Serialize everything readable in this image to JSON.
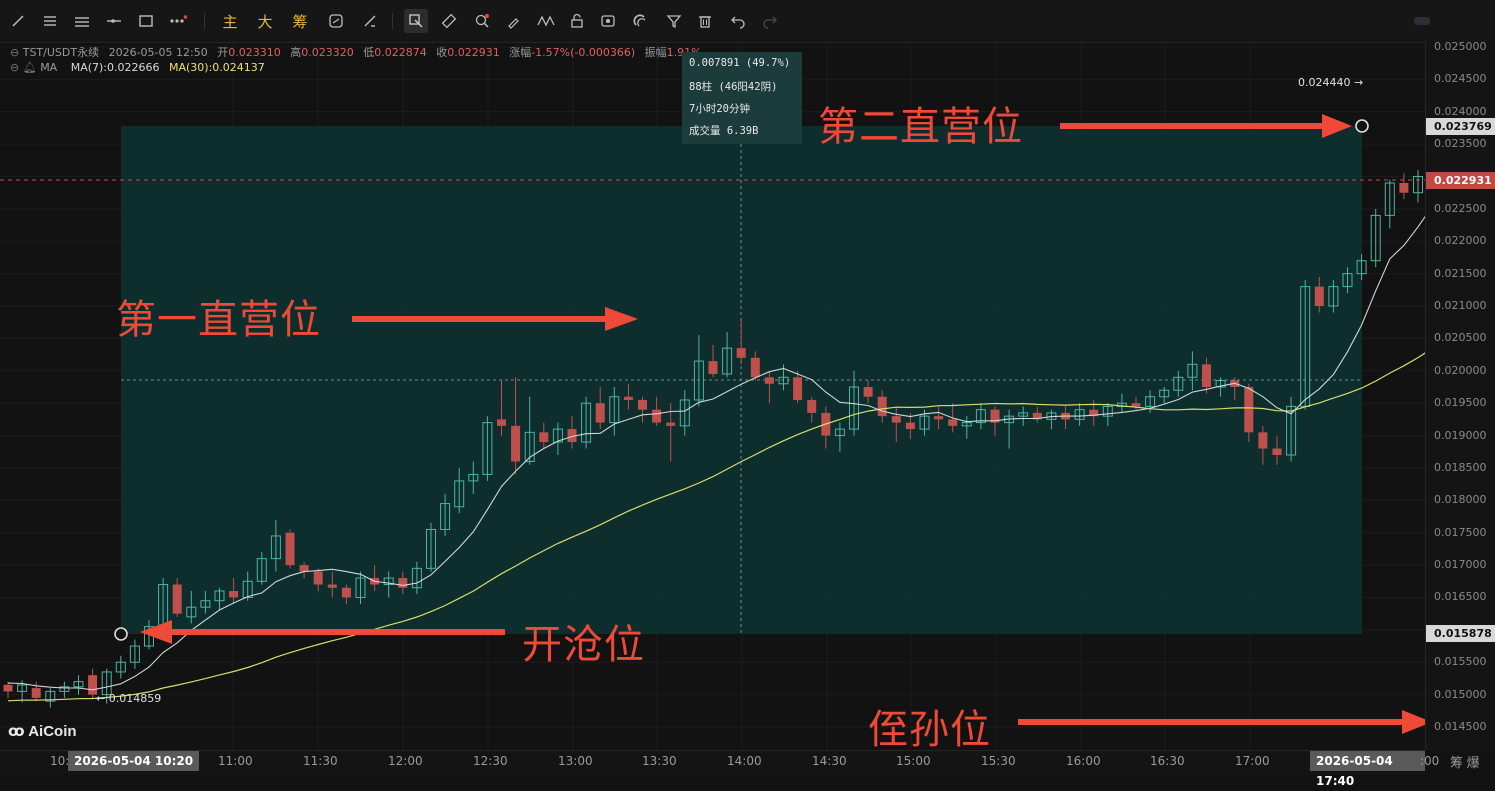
{
  "toolbar": {
    "tools": [
      "trend-line-icon",
      "horizontal-lines-icon",
      "parallel-lines-icon",
      "horizontal-ray-icon",
      "rectangle-icon",
      "more-dots-icon"
    ],
    "text_tools": [
      "主",
      "大",
      "筹"
    ],
    "tools2": [
      "replay-icon",
      "ruler-draw-icon",
      "price-range-icon",
      "ruler-icon",
      "zoom-icon",
      "brush-icon",
      "pattern-icon",
      "lock-icon",
      "eye-icon",
      "magnet-icon",
      "filter-icon",
      "trash-icon",
      "undo-icon",
      "redo-icon"
    ]
  },
  "info": {
    "symbol": "TST/USDT永续",
    "datetime": "2026-05-05 12:50",
    "open_label": "开",
    "open": "0.023310",
    "high_label": "高",
    "high": "0.023320",
    "low_label": "低",
    "low": "0.022874",
    "close_label": "收",
    "close": "0.022931",
    "change_label": "涨幅",
    "change": "-1.57%(-0.000366)",
    "amp_label": "振幅",
    "amp": "1.91%",
    "indicator": "MA",
    "ma7": "MA(7):0.022666",
    "ma30": "MA(30):0.024137"
  },
  "measure": {
    "line1": "0.007891 (49.7%)",
    "line2": "88柱 (46阳42阴)",
    "line3": "7小时20分钟",
    "line4": "成交量 6.39B"
  },
  "annotations": {
    "first_level": "第一直营位",
    "second_level": "第二直营位",
    "open_position": "开沧位",
    "stop_loss": "侄孙位"
  },
  "price_labels": {
    "high_mark": "0.024440",
    "low_mark": "0.014859"
  },
  "price_axis": {
    "ticks": [
      "0.025000",
      "0.024500",
      "0.024000",
      "0.023500",
      "0.023000",
      "0.022500",
      "0.022000",
      "0.021500",
      "0.021000",
      "0.020500",
      "0.020000",
      "0.019500",
      "0.019000",
      "0.018500",
      "0.018000",
      "0.017500",
      "0.017000",
      "0.016500",
      "0.016000",
      "0.015500",
      "0.015000",
      "0.014500"
    ],
    "box_top": "0.023769",
    "box_current": "0.022931",
    "box_bottom": "0.015878"
  },
  "time_axis": {
    "ticks": [
      "11:00",
      "11:30",
      "12:00",
      "12:30",
      "13:00",
      "13:30",
      "14:00",
      "14:30",
      "15:00",
      "15:30",
      "16:00",
      "16:30",
      "17:00"
    ],
    "left_stub": "10:",
    "right_stub": ":00",
    "start_box": "2026-05-04 10:20",
    "end_box": "2026-05-04 17:40"
  },
  "logo": "AiCoin",
  "corner": "筹 爆",
  "chart_data": {
    "type": "candlestick",
    "title": "",
    "interval": "5m",
    "ylim": [
      0.0143,
      0.0251
    ],
    "up_color": "#4fb3a4",
    "down_color": "#c0504d",
    "ma7_color": "#cfd6d6",
    "ma30_color": "#d6dc6a",
    "candles": [
      [
        0.01515,
        0.0152,
        0.01495,
        0.01505
      ],
      [
        0.01505,
        0.01522,
        0.01488,
        0.01515
      ],
      [
        0.0151,
        0.0152,
        0.0149,
        0.01495
      ],
      [
        0.0149,
        0.0151,
        0.0148,
        0.01505
      ],
      [
        0.01505,
        0.0152,
        0.01495,
        0.01512
      ],
      [
        0.01512,
        0.0153,
        0.015,
        0.0152
      ],
      [
        0.0153,
        0.0154,
        0.01495,
        0.015
      ],
      [
        0.015,
        0.0154,
        0.01486,
        0.01535
      ],
      [
        0.01535,
        0.0156,
        0.01525,
        0.0155
      ],
      [
        0.0155,
        0.01585,
        0.0154,
        0.01575
      ],
      [
        0.01575,
        0.01615,
        0.0157,
        0.01605
      ],
      [
        0.016,
        0.0168,
        0.01595,
        0.0167
      ],
      [
        0.0167,
        0.0168,
        0.0162,
        0.01625
      ],
      [
        0.0162,
        0.0166,
        0.0161,
        0.01635
      ],
      [
        0.01635,
        0.0166,
        0.01625,
        0.01645
      ],
      [
        0.01645,
        0.01665,
        0.0163,
        0.0166
      ],
      [
        0.0166,
        0.0168,
        0.0164,
        0.0165
      ],
      [
        0.0165,
        0.0169,
        0.01645,
        0.01675
      ],
      [
        0.01675,
        0.0172,
        0.0167,
        0.0171
      ],
      [
        0.0171,
        0.0177,
        0.0169,
        0.01745
      ],
      [
        0.0175,
        0.01755,
        0.01695,
        0.017
      ],
      [
        0.017,
        0.01705,
        0.0168,
        0.0169
      ],
      [
        0.0169,
        0.01695,
        0.0166,
        0.0167
      ],
      [
        0.0167,
        0.0169,
        0.0165,
        0.01665
      ],
      [
        0.01665,
        0.0167,
        0.0164,
        0.0165
      ],
      [
        0.0165,
        0.0169,
        0.0164,
        0.0168
      ],
      [
        0.0168,
        0.017,
        0.0166,
        0.0167
      ],
      [
        0.0167,
        0.0169,
        0.0165,
        0.0168
      ],
      [
        0.0168,
        0.0169,
        0.01655,
        0.01665
      ],
      [
        0.01665,
        0.01705,
        0.01655,
        0.01695
      ],
      [
        0.01695,
        0.01765,
        0.0169,
        0.01755
      ],
      [
        0.01755,
        0.0181,
        0.01745,
        0.01795
      ],
      [
        0.0179,
        0.0185,
        0.0178,
        0.0183
      ],
      [
        0.0183,
        0.0186,
        0.0181,
        0.0184
      ],
      [
        0.0184,
        0.0193,
        0.0183,
        0.0192
      ],
      [
        0.01925,
        0.01985,
        0.019,
        0.01915
      ],
      [
        0.01915,
        0.0199,
        0.0184,
        0.0186
      ],
      [
        0.0186,
        0.0196,
        0.01855,
        0.01905
      ],
      [
        0.01905,
        0.0192,
        0.0188,
        0.0189
      ],
      [
        0.0189,
        0.0192,
        0.0187,
        0.0191
      ],
      [
        0.0191,
        0.0193,
        0.0188,
        0.0189
      ],
      [
        0.0189,
        0.0196,
        0.0188,
        0.0195
      ],
      [
        0.0195,
        0.01975,
        0.0191,
        0.0192
      ],
      [
        0.0192,
        0.01975,
        0.019,
        0.0196
      ],
      [
        0.0196,
        0.0198,
        0.0194,
        0.01955
      ],
      [
        0.01955,
        0.0196,
        0.0192,
        0.0194
      ],
      [
        0.0194,
        0.0196,
        0.01915,
        0.0192
      ],
      [
        0.0192,
        0.0195,
        0.0186,
        0.01915
      ],
      [
        0.01915,
        0.0197,
        0.019,
        0.01955
      ],
      [
        0.01955,
        0.02055,
        0.01945,
        0.02015
      ],
      [
        0.02015,
        0.0204,
        0.0199,
        0.01995
      ],
      [
        0.01995,
        0.0206,
        0.0199,
        0.02035
      ],
      [
        0.02035,
        0.0208,
        0.0201,
        0.0202
      ],
      [
        0.0202,
        0.0203,
        0.01985,
        0.0199
      ],
      [
        0.0199,
        0.02,
        0.0195,
        0.0198
      ],
      [
        0.0198,
        0.0201,
        0.0197,
        0.0199
      ],
      [
        0.0199,
        0.02,
        0.0195,
        0.01955
      ],
      [
        0.01955,
        0.0196,
        0.0192,
        0.01935
      ],
      [
        0.01935,
        0.01945,
        0.0188,
        0.019
      ],
      [
        0.019,
        0.0192,
        0.01875,
        0.0191
      ],
      [
        0.0191,
        0.02,
        0.019,
        0.01975
      ],
      [
        0.01975,
        0.01985,
        0.0195,
        0.0196
      ],
      [
        0.0196,
        0.0197,
        0.0192,
        0.0193
      ],
      [
        0.0193,
        0.01945,
        0.0189,
        0.0192
      ],
      [
        0.0192,
        0.01935,
        0.01895,
        0.0191
      ],
      [
        0.0191,
        0.0194,
        0.019,
        0.0193
      ],
      [
        0.0193,
        0.01945,
        0.0191,
        0.01925
      ],
      [
        0.01925,
        0.0195,
        0.01905,
        0.01915
      ],
      [
        0.01915,
        0.0193,
        0.01895,
        0.0192
      ],
      [
        0.0192,
        0.0195,
        0.0191,
        0.0194
      ],
      [
        0.0194,
        0.01945,
        0.019,
        0.0192
      ],
      [
        0.0192,
        0.0194,
        0.0188,
        0.0193
      ],
      [
        0.0193,
        0.01945,
        0.01915,
        0.01935
      ],
      [
        0.01935,
        0.01945,
        0.0192,
        0.01925
      ],
      [
        0.01925,
        0.0194,
        0.0191,
        0.01935
      ],
      [
        0.01935,
        0.01945,
        0.0191,
        0.01925
      ],
      [
        0.01925,
        0.0195,
        0.01915,
        0.0194
      ],
      [
        0.0194,
        0.01955,
        0.01915,
        0.0193
      ],
      [
        0.0193,
        0.0195,
        0.01915,
        0.01945
      ],
      [
        0.01945,
        0.01965,
        0.01935,
        0.0195
      ],
      [
        0.0195,
        0.0196,
        0.0194,
        0.01945
      ],
      [
        0.01945,
        0.0197,
        0.01935,
        0.0196
      ],
      [
        0.0196,
        0.01975,
        0.0195,
        0.0197
      ],
      [
        0.0197,
        0.02,
        0.0196,
        0.0199
      ],
      [
        0.0199,
        0.0203,
        0.0197,
        0.0201
      ],
      [
        0.0201,
        0.0202,
        0.01965,
        0.01975
      ],
      [
        0.01975,
        0.0199,
        0.0196,
        0.01985
      ],
      [
        0.01985,
        0.0199,
        0.01955,
        0.01975
      ],
      [
        0.01975,
        0.0198,
        0.0189,
        0.01905
      ],
      [
        0.01905,
        0.01915,
        0.01855,
        0.0188
      ],
      [
        0.0188,
        0.019,
        0.01855,
        0.0187
      ],
      [
        0.0187,
        0.0196,
        0.0186,
        0.01945
      ],
      [
        0.01945,
        0.0214,
        0.0194,
        0.0213
      ],
      [
        0.0213,
        0.02145,
        0.0209,
        0.021
      ],
      [
        0.021,
        0.0214,
        0.0209,
        0.0213
      ],
      [
        0.0213,
        0.0216,
        0.0212,
        0.0215
      ],
      [
        0.0215,
        0.0218,
        0.0214,
        0.0217
      ],
      [
        0.0217,
        0.0225,
        0.0216,
        0.0224
      ],
      [
        0.0224,
        0.02295,
        0.0222,
        0.0229
      ],
      [
        0.0229,
        0.02305,
        0.02265,
        0.02275
      ],
      [
        0.02275,
        0.0231,
        0.0226,
        0.023
      ],
      [
        0.023,
        0.0236,
        0.0228,
        0.0235
      ],
      [
        0.0235,
        0.0239,
        0.0234,
        0.02365
      ],
      [
        0.02365,
        0.02395,
        0.0233,
        0.0238
      ],
      [
        0.0238,
        0.02444,
        0.0236,
        0.0237
      ],
      [
        0.0237,
        0.02385,
        0.023,
        0.0232
      ],
      [
        0.0232,
        0.0234,
        0.0228,
        0.023
      ],
      [
        0.023,
        0.0231,
        0.0224,
        0.0227
      ],
      [
        0.0227,
        0.0229,
        0.0225,
        0.0228
      ]
    ]
  }
}
